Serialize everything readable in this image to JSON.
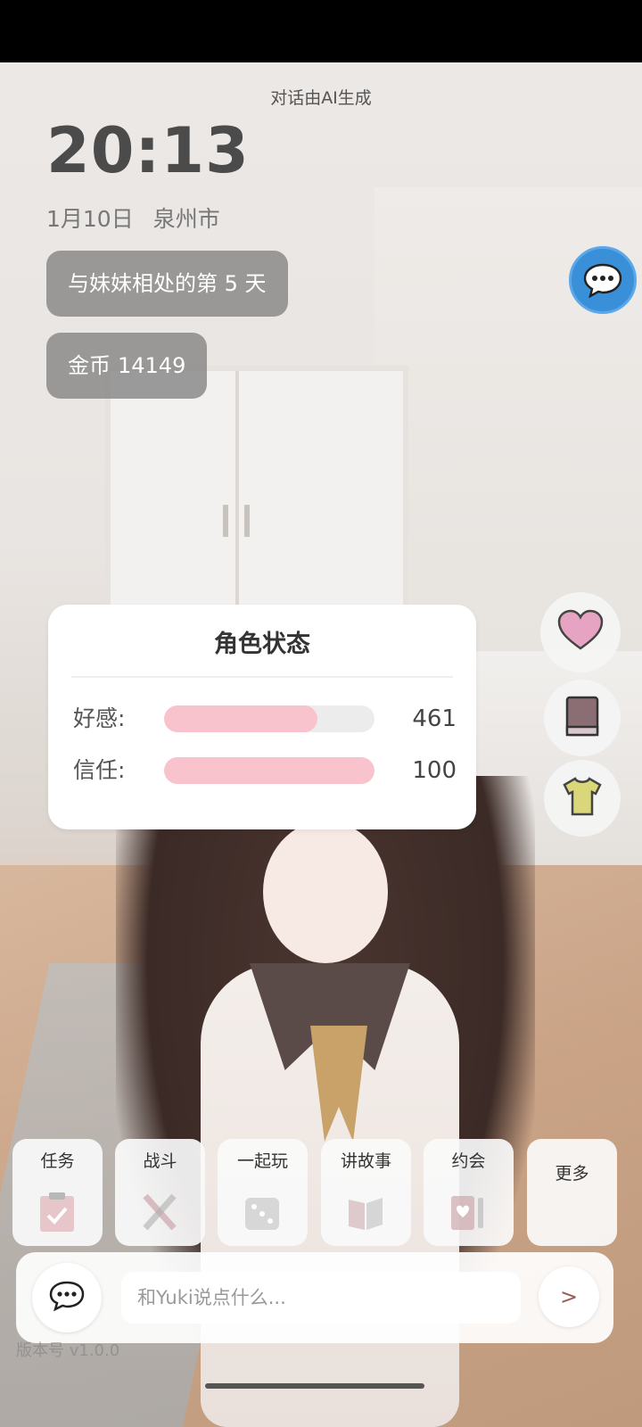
{
  "header": {
    "ai_label": "对话由AI生成"
  },
  "clock": {
    "time": "20:13",
    "date": "1月10日",
    "city": "泉州市"
  },
  "info": {
    "days_together": "与妹妹相处的第 5 天",
    "coins_label": "金币",
    "coins_value": "14149"
  },
  "floating": {
    "chat_icon": "chat-bubble-icon"
  },
  "status_card": {
    "title": "角色状态",
    "stats": [
      {
        "label": "好感:",
        "value": "461",
        "progress": 0.73
      },
      {
        "label": "信任:",
        "value": "100",
        "progress": 1.0
      }
    ]
  },
  "side_buttons": [
    {
      "icon": "heart-icon"
    },
    {
      "icon": "book-icon"
    },
    {
      "icon": "shirt-icon"
    }
  ],
  "actions": [
    {
      "label": "任务",
      "icon": "clipboard-icon"
    },
    {
      "label": "战斗",
      "icon": "crossed-swords-icon"
    },
    {
      "label": "一起玩",
      "icon": "dice-icon"
    },
    {
      "label": "讲故事",
      "icon": "open-book-icon"
    },
    {
      "label": "约会",
      "icon": "date-card-icon"
    },
    {
      "label": "更多",
      "icon": ""
    }
  ],
  "input": {
    "placeholder": "和Yuki说点什么...",
    "send_label": ">"
  },
  "footer": {
    "version": "版本号 v1.0.0"
  },
  "colors": {
    "accent_pink": "#f8c3cc",
    "chat_blue": "#3a8fd9",
    "heart_pink": "#e7a3c2",
    "shirt_yellow": "#d9d77a"
  }
}
